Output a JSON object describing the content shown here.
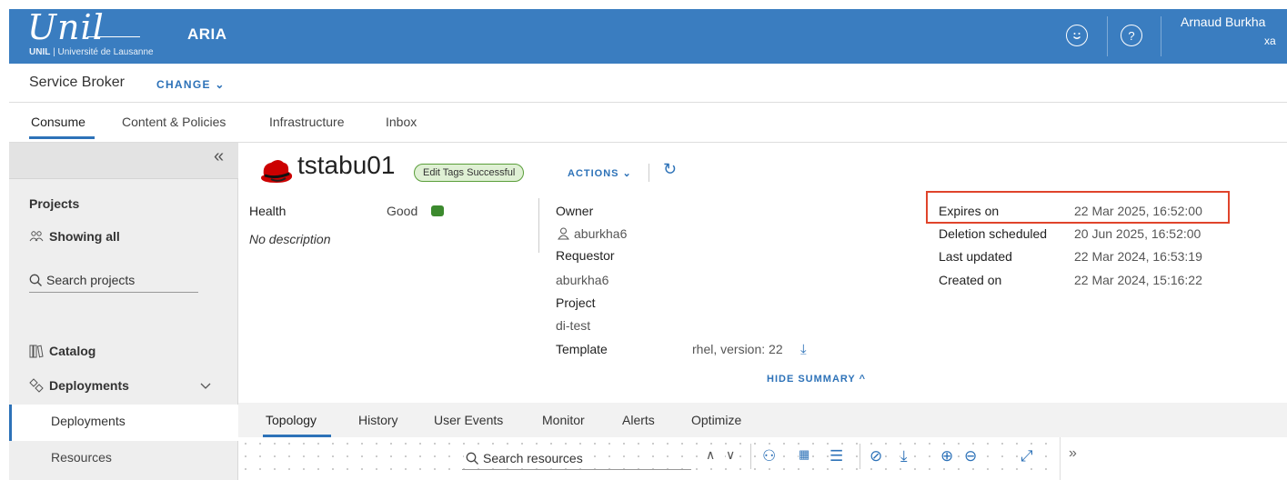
{
  "header": {
    "logo_script": "Unil",
    "logo_sub_bold": "UNIL",
    "logo_sub_rest": " | Université de Lausanne",
    "app_name": "ARIA",
    "user_name": "Arnaud Burkha",
    "user_sub": "xa"
  },
  "broker": {
    "title": "Service Broker",
    "change": "CHANGE ⌄"
  },
  "main_tabs": [
    "Consume",
    "Content & Policies",
    "Infrastructure",
    "Inbox"
  ],
  "sidebar": {
    "collapse": "«",
    "projects_heading": "Projects",
    "showing_all": "Showing all",
    "search_placeholder": "Search projects",
    "catalog": "Catalog",
    "deployments_group": "Deployments",
    "items": [
      "Deployments",
      "Resources"
    ]
  },
  "deployment": {
    "name": "tstabu01",
    "tag_badge": "Edit Tags Successful",
    "actions": "ACTIONS ⌄",
    "health_label": "Health",
    "health_value": "Good",
    "description": "No description",
    "owner_label": "Owner",
    "owner_value": "aburkha6",
    "requestor_label": "Requestor",
    "requestor_value": "aburkha6",
    "project_label": "Project",
    "project_value": "di-test",
    "template_label": "Template",
    "template_value": "rhel, version: 22",
    "expires_label": "Expires on",
    "expires_value": "22 Mar 2025, 16:52:00",
    "deletion_label": "Deletion scheduled",
    "deletion_value": "20 Jun 2025, 16:52:00",
    "updated_label": "Last updated",
    "updated_value": "22 Mar 2024, 16:53:19",
    "created_label": "Created on",
    "created_value": "22 Mar 2024, 15:16:22",
    "hide_summary": "HIDE SUMMARY ^"
  },
  "bottom_tabs": [
    "Topology",
    "History",
    "User Events",
    "Monitor",
    "Alerts",
    "Optimize"
  ],
  "topology": {
    "search_placeholder": "Search resources",
    "side_toggle": "»"
  },
  "colors": {
    "header_bg": "#3a7dc0",
    "accent": "#2d72b8",
    "highlight_box": "#e0442b",
    "health_good": "#3c8a2e"
  }
}
